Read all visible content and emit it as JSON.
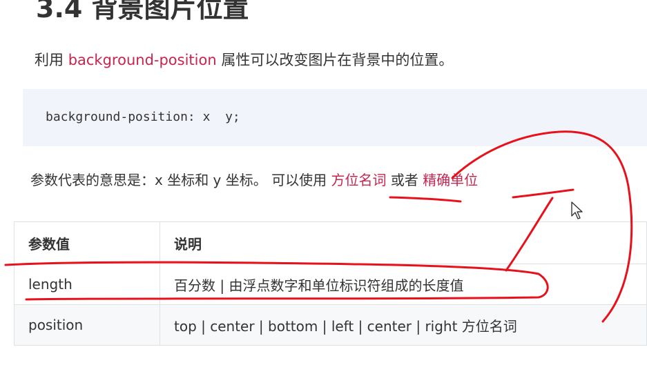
{
  "heading": "3.4 背景图片位置",
  "intro": {
    "prefix": "利用 ",
    "keyword": "background-position",
    "suffix": " 属性可以改变图片在背景中的位置。"
  },
  "code": "background-position: x  y;",
  "params": {
    "prefix": "参数代表的意思是：x 坐标和 y 坐标。 可以使用 ",
    "option1": "方位名词",
    "middle": " 或者 ",
    "option2": "精确单位"
  },
  "table": {
    "headers": [
      "参数值",
      "说明"
    ],
    "rows": [
      [
        "length",
        "百分数 | 由浮点数字和单位标识符组成的长度值"
      ],
      [
        "position",
        "top | center | bottom | left | center | right  方位名词"
      ]
    ]
  },
  "colors": {
    "keyword": "#c7254e",
    "annotation": "#e8101a",
    "code_bg": "#f2f4fb"
  }
}
